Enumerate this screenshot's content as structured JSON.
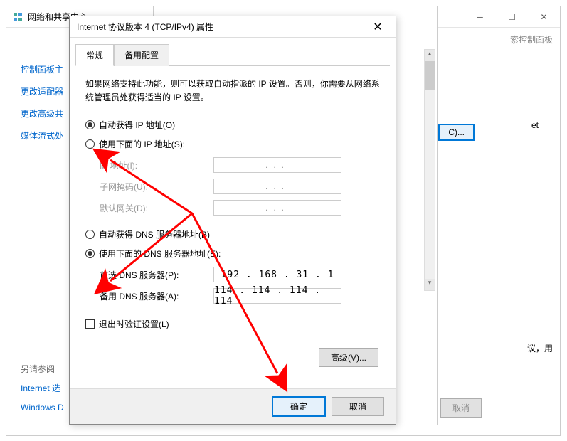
{
  "bg": {
    "title": "网络和共享中心",
    "sidebar": {
      "items": [
        "控制面板主",
        "更改适配器",
        "更改高级共",
        "媒体流式处"
      ]
    },
    "search_placeholder": "索控制面板",
    "c_button": "C)...",
    "right_text": "et",
    "advice_text": "议，用",
    "bottom_label": "另请参阅",
    "bottom_links": [
      "Internet 选",
      "Windows D"
    ],
    "cancel": "取消"
  },
  "dialog": {
    "title": "Internet 协议版本 4 (TCP/IPv4) 属性",
    "tabs": [
      "常规",
      "备用配置"
    ],
    "description": "如果网络支持此功能，则可以获取自动指派的 IP 设置。否则，你需要从网络系统管理员处获得适当的 IP 设置。",
    "ip_section": {
      "auto": "自动获得 IP 地址(O)",
      "manual": "使用下面的 IP 地址(S):",
      "ip_label": "IP 地址(I):",
      "mask_label": "子网掩码(U):",
      "gateway_label": "默认网关(D):"
    },
    "dns_section": {
      "auto": "自动获得 DNS 服务器地址(B)",
      "manual": "使用下面的 DNS 服务器地址(E):",
      "pref_label": "首选 DNS 服务器(P):",
      "alt_label": "备用 DNS 服务器(A):",
      "pref_value": "192 . 168 .  31  .   1",
      "alt_value": "114 . 114 . 114 . 114"
    },
    "validate_checkbox": "退出时验证设置(L)",
    "advanced": "高级(V)...",
    "ok": "确定",
    "cancel": "取消"
  }
}
